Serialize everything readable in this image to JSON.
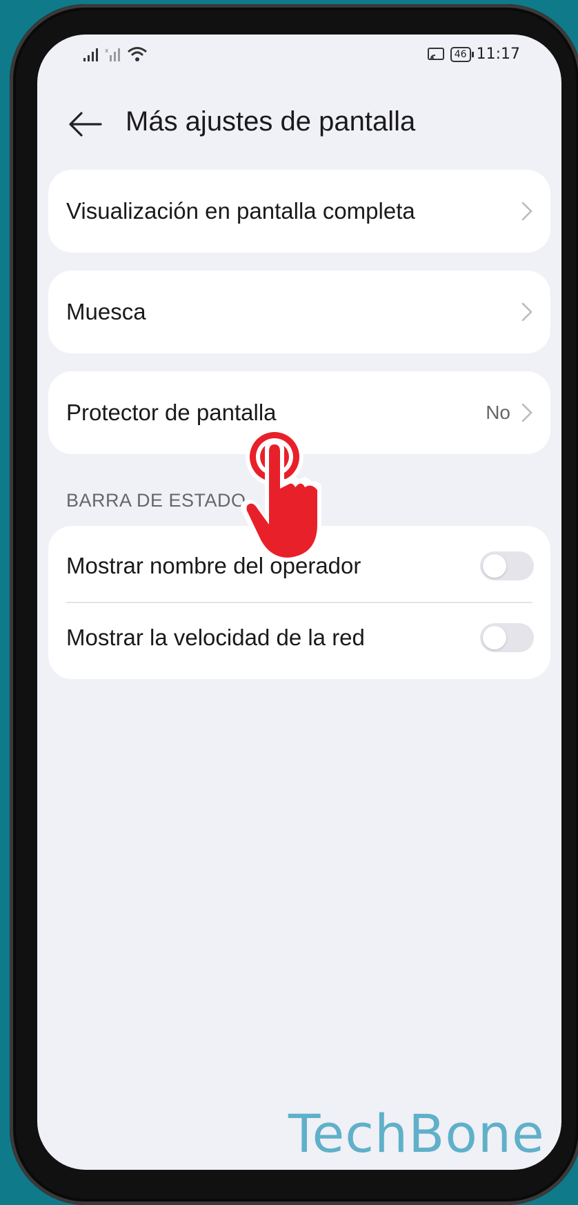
{
  "status_bar": {
    "time": "11:17",
    "battery": "46",
    "icons": [
      "signal-icon",
      "signal-no-sim-icon",
      "wifi-icon",
      "screencast-icon",
      "battery-icon"
    ]
  },
  "header": {
    "back_icon": "arrow-left-icon",
    "title": "Más ajustes de pantalla"
  },
  "settings": {
    "fullscreen_display": "Visualización en pantalla completa",
    "notch": "Muesca",
    "screen_saver": {
      "label": "Protector de pantalla",
      "value": "No"
    }
  },
  "status_bar_section": {
    "header": "BARRA DE ESTADO",
    "show_carrier": {
      "label": "Mostrar nombre del operador",
      "enabled": false
    },
    "show_speed": {
      "label": "Mostrar la velocidad de la red",
      "enabled": false
    }
  },
  "watermark": "TechBone",
  "colors": {
    "background": "#0f7a8a",
    "screen": "#f0f0f7",
    "tap_indicator": "#e8202a",
    "watermark": "#5fb0c8"
  }
}
